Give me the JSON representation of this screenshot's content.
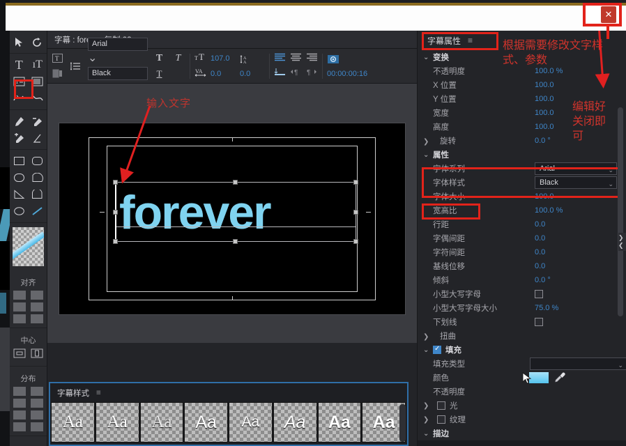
{
  "window": {
    "close_label": "✕",
    "accent_red": "#e2231a",
    "highlight_blue": "#3f86c9"
  },
  "toolbar": {
    "tools": [
      {
        "name": "selection-tool",
        "glyph": "▶"
      },
      {
        "name": "rotate-tool",
        "glyph": "↻"
      },
      {
        "name": "type-tool",
        "glyph": "T"
      },
      {
        "name": "vertical-type-tool",
        "glyph": "IT"
      },
      {
        "name": "area-type-tool",
        "glyph": "▤"
      },
      {
        "name": "vertical-area-type-tool",
        "glyph": "▥"
      },
      {
        "name": "path-type-tool",
        "glyph": "↝"
      },
      {
        "name": "vertical-path-type-tool",
        "glyph": "↜"
      },
      {
        "name": "pen-tool",
        "glyph": "✒"
      },
      {
        "name": "delete-anchor-tool",
        "glyph": "✑"
      },
      {
        "name": "add-anchor-tool",
        "glyph": "✎"
      },
      {
        "name": "convert-anchor-tool",
        "glyph": "∠"
      },
      {
        "name": "rectangle-tool",
        "glyph": "▭"
      },
      {
        "name": "rounded-rectangle-tool",
        "glyph": "▢"
      },
      {
        "name": "clipped-rectangle-tool",
        "glyph": "⬭"
      },
      {
        "name": "wedge-tool",
        "glyph": "◯"
      },
      {
        "name": "triangle-tool",
        "glyph": "◺"
      },
      {
        "name": "arc-tool",
        "glyph": "◠"
      },
      {
        "name": "ellipse-tool",
        "glyph": "◯"
      },
      {
        "name": "line-tool",
        "glyph": "╱"
      }
    ],
    "align_label": "对齐",
    "center_label": "中心",
    "distribute_label": "分布"
  },
  "title_panel": {
    "tab_title": "字幕 : forever 复制 02",
    "menu_glyph": "≡"
  },
  "font_bar": {
    "font_family": "Arial",
    "font_style": "Black",
    "font_size": "107.0",
    "kerning": "0.0",
    "leading": "0.0",
    "timecode": "00:00:00:16",
    "bold_glyph": "T",
    "italic_glyph": "T",
    "underline_glyph": "T"
  },
  "canvas": {
    "annotation_input_text": "输入文字",
    "text_content": "forever",
    "text_color": "#7fd3f0"
  },
  "styles_panel": {
    "title": "字幕样式",
    "menu_glyph": "≡",
    "tiles": [
      "Aa",
      "Aa",
      "Aa",
      "Aa",
      "Aa",
      "Aa",
      "Aa",
      "Aa"
    ]
  },
  "properties": {
    "panel_title": "字幕属性",
    "menu_glyph": "≡",
    "annotation_modify": "根据需要修改文字样式、参数",
    "annotation_close": "编辑好关闭即可",
    "groups": [
      {
        "name": "变换",
        "rows": [
          {
            "label": "不透明度",
            "value": "100.0 %"
          },
          {
            "label": "X 位置",
            "value": "100.0"
          },
          {
            "label": "Y 位置",
            "value": "100.0"
          },
          {
            "label": "宽度",
            "value": "100.0"
          },
          {
            "label": "高度",
            "value": "100.0"
          },
          {
            "label": "旋转",
            "value": "0.0 °",
            "expandable": true
          }
        ]
      },
      {
        "name": "属性",
        "rows": [
          {
            "label": "字体系列",
            "value": "Arial",
            "control": "select"
          },
          {
            "label": "字体样式",
            "value": "Black",
            "control": "select"
          },
          {
            "label": "字体大小",
            "value": "100.0"
          },
          {
            "label": "宽高比",
            "value": "100.0 %"
          },
          {
            "label": "行距",
            "value": "0.0"
          },
          {
            "label": "字偶间距",
            "value": "0.0"
          },
          {
            "label": "字符间距",
            "value": "0.0"
          },
          {
            "label": "基线位移",
            "value": "0.0"
          },
          {
            "label": "倾斜",
            "value": "0.0 °"
          },
          {
            "label": "小型大写字母",
            "value": "",
            "control": "checkbox"
          },
          {
            "label": "小型大写字母大小",
            "value": "75.0 %"
          },
          {
            "label": "下划线",
            "value": "",
            "control": "checkbox"
          },
          {
            "label": "扭曲",
            "value": "",
            "expandable": true
          }
        ]
      },
      {
        "name": "填充",
        "checked": true,
        "rows": [
          {
            "label": "填充类型",
            "value": "",
            "control": "select"
          },
          {
            "label": "颜色",
            "value": "",
            "control": "swatch"
          },
          {
            "label": "不透明度",
            "value": ""
          },
          {
            "label": "光",
            "value": "",
            "control": "checkbox",
            "expandable": true
          },
          {
            "label": "纹理",
            "value": "",
            "control": "checkbox",
            "expandable": true
          }
        ]
      },
      {
        "name": "描边",
        "rows": []
      }
    ]
  }
}
